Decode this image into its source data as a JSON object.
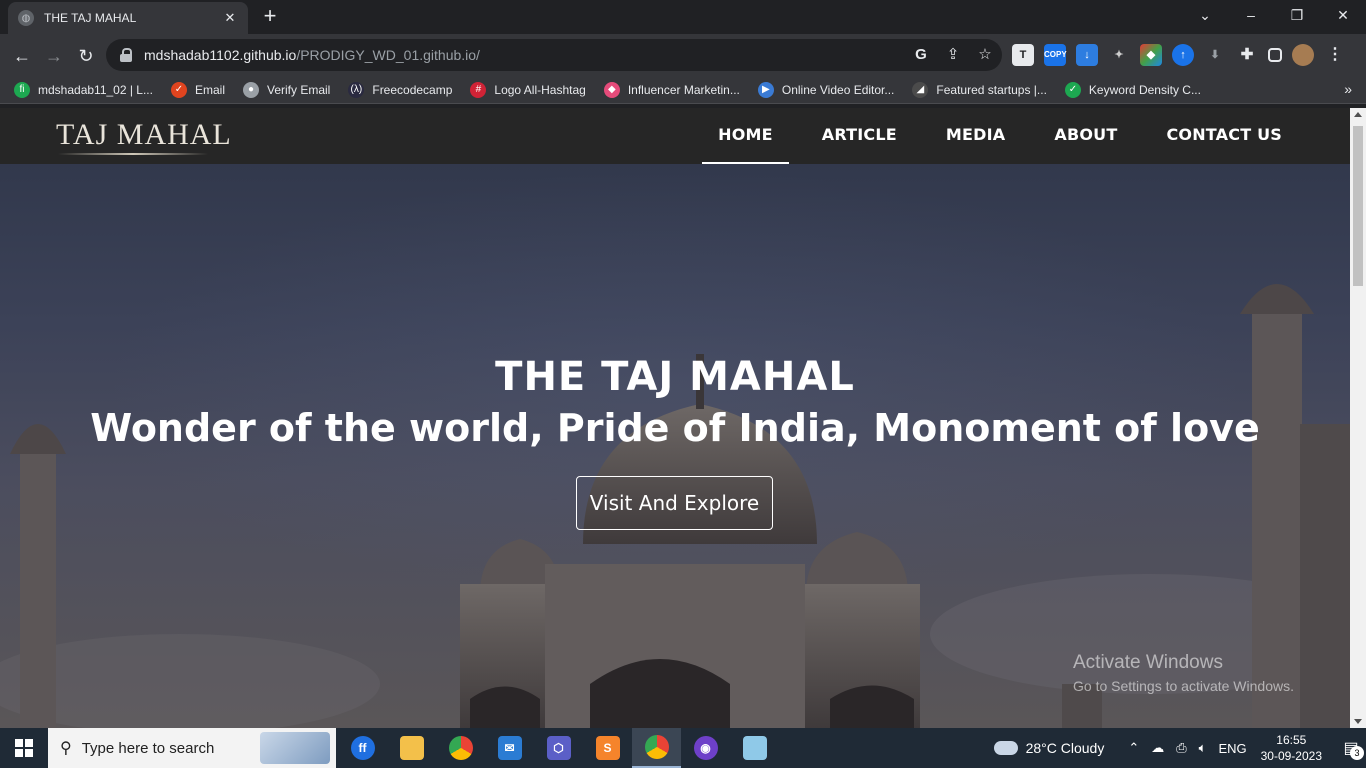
{
  "browser": {
    "tab_title": "THE TAJ MAHAL",
    "url_host": "mdshadab1102.github.io",
    "url_path": "/PRODIGY_WD_01.github.io/",
    "bookmarks": [
      {
        "label": "mdshadab11_02 | L...",
        "color": "#1da851",
        "glyph": "fi"
      },
      {
        "label": "Email",
        "color": "#e0441f",
        "glyph": "✓"
      },
      {
        "label": "Verify Email",
        "color": "#9aa0a6",
        "glyph": "●"
      },
      {
        "label": "Freecodecamp",
        "color": "#2a2a40",
        "glyph": "(λ)"
      },
      {
        "label": "Logo All-Hashtag",
        "color": "#d02336",
        "glyph": "#"
      },
      {
        "label": "Influencer Marketin...",
        "color": "#e54b7a",
        "glyph": "◆"
      },
      {
        "label": "Online Video Editor...",
        "color": "#3a7bd5",
        "glyph": "▶"
      },
      {
        "label": "Featured startups |...",
        "color": "#4b4b4b",
        "glyph": "◢"
      },
      {
        "label": "Keyword Density C...",
        "color": "#1da851",
        "glyph": "✓"
      }
    ]
  },
  "site": {
    "logo": "TAJ MAHAL",
    "nav": [
      {
        "label": "HOME",
        "active": true
      },
      {
        "label": "ARTICLE",
        "active": false
      },
      {
        "label": "MEDIA",
        "active": false
      },
      {
        "label": "ABOUT",
        "active": false
      },
      {
        "label": "CONTACT US",
        "active": false
      }
    ],
    "hero_title": "THE TAJ MAHAL",
    "hero_subtitle": "Wonder of the world, Pride of India, Monoment of love",
    "hero_button": "Visit And Explore"
  },
  "watermark": {
    "line1": "Activate Windows",
    "line2": "Go to Settings to activate Windows."
  },
  "taskbar": {
    "search_placeholder": "Type here to search",
    "weather": "28°C  Cloudy",
    "language": "ENG",
    "time": "16:55",
    "date": "30-09-2023",
    "notification_count": "3"
  },
  "colors": {
    "site_nav_bg": "#262626",
    "accent": "#ffffff"
  }
}
